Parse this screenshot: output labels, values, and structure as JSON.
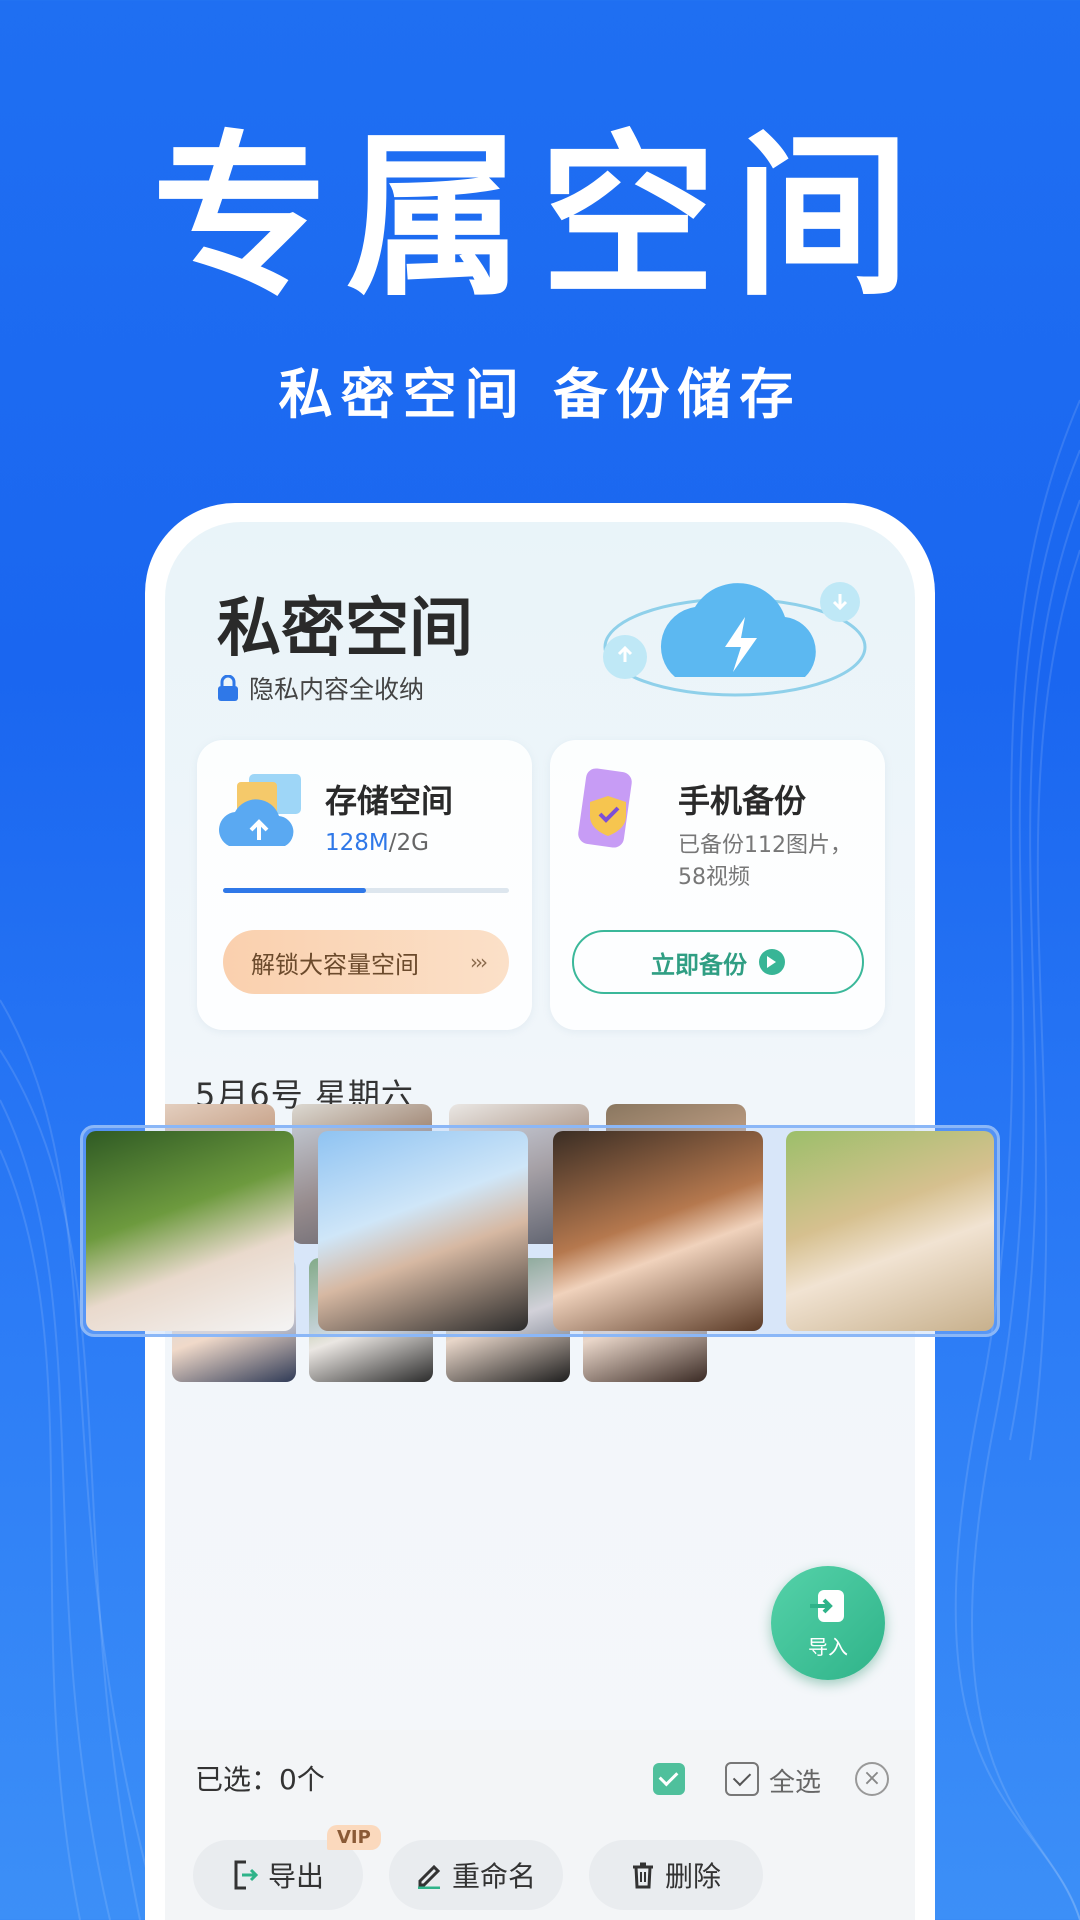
{
  "hero": {
    "title": "专属空间",
    "subtitle": "私密空间 备份储存"
  },
  "private_space": {
    "title": "私密空间",
    "subtitle": "隐私内容全收纳"
  },
  "storage_card": {
    "title": "存储空间",
    "used": "128M",
    "total": "/2G",
    "progress": 0.5,
    "unlock_label": "解锁大容量空间",
    "unlock_arrow": "›››"
  },
  "backup_card": {
    "title": "手机备份",
    "info": "已备份112图片，58视频",
    "button_label": "立即备份"
  },
  "date_label": "5月6号  星期六",
  "bottom": {
    "selected": "已选：0个",
    "select_all": "全选",
    "export": "导出",
    "vip": "VIP",
    "rename": "重命名",
    "delete": "删除",
    "close": "×"
  },
  "import_label": "导入",
  "colors": {
    "accent": "#1f6ff2",
    "green": "#38b596",
    "storage_blue": "#2f78e8"
  }
}
